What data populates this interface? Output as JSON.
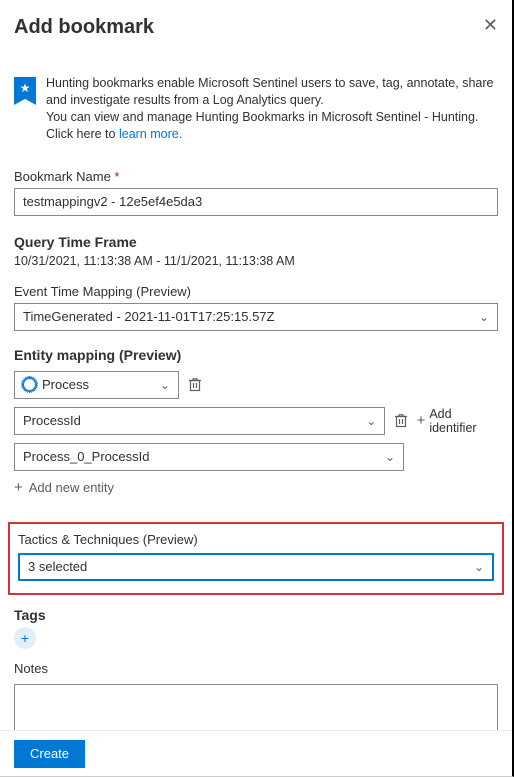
{
  "header": {
    "title": "Add bookmark"
  },
  "intro": {
    "line1": "Hunting bookmarks enable Microsoft Sentinel users to save, tag, annotate, share and investigate results from a Log Analytics query.",
    "line2": "You can view and manage Hunting Bookmarks in Microsoft Sentinel - Hunting.",
    "clickHere": "Click here to",
    "learnMore": "learn more."
  },
  "bookmarkName": {
    "label": "Bookmark Name",
    "value": "testmappingv2 - 12e5ef4e5da3"
  },
  "queryTimeFrame": {
    "label": "Query Time Frame",
    "value": "10/31/2021, 11:13:38 AM - 11/1/2021, 11:13:38 AM"
  },
  "eventTimeMapping": {
    "label": "Event Time Mapping (Preview)",
    "value": "TimeGenerated - 2021-11-01T17:25:15.57Z"
  },
  "entityMapping": {
    "label": "Entity mapping (Preview)",
    "entityType": "Process",
    "identifierKey": "ProcessId",
    "identifierValue": "Process_0_ProcessId",
    "addIdentifier": "Add identifier",
    "addEntity": "Add new entity"
  },
  "tactics": {
    "label": "Tactics & Techniques (Preview)",
    "value": "3 selected"
  },
  "tags": {
    "label": "Tags"
  },
  "notes": {
    "label": "Notes"
  },
  "footer": {
    "create": "Create"
  }
}
